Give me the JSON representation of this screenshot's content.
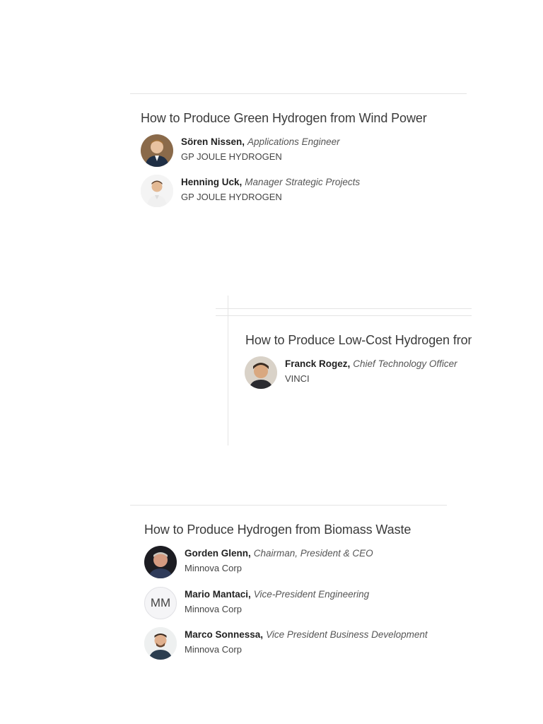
{
  "sessions": [
    {
      "title": "How to Produce Green Hydrogen from Wind Power",
      "speakers": [
        {
          "name": "Sören Nissen",
          "role": "Applications Engineer",
          "company": "GP JOULE HYDROGEN",
          "avatar": "photo-avatar"
        },
        {
          "name": "Henning Uck",
          "role": "Manager Strategic Projects",
          "company": "GP JOULE HYDROGEN",
          "avatar": "photo-avatar"
        }
      ]
    },
    {
      "title": "How to Produce Low-Cost Hydrogen from S",
      "speakers": [
        {
          "name": "Franck Rogez",
          "role": "Chief Technology Officer",
          "company": "VINCI",
          "avatar": "photo-avatar"
        }
      ]
    },
    {
      "title": "How to Produce Hydrogen from Biomass Waste",
      "speakers": [
        {
          "name": "Gorden Glenn",
          "role": "Chairman, President & CEO",
          "company": "Minnova Corp",
          "avatar": "photo-avatar"
        },
        {
          "name": "Mario Mantaci",
          "role": "Vice-President Engineering",
          "company": "Minnova Corp",
          "avatar": "initials-avatar",
          "initials": "MM"
        },
        {
          "name": "Marco Sonnessa",
          "role": "Vice President Business Development",
          "company": "Minnova Corp",
          "avatar": "photo-avatar"
        }
      ]
    }
  ],
  "separator": ","
}
